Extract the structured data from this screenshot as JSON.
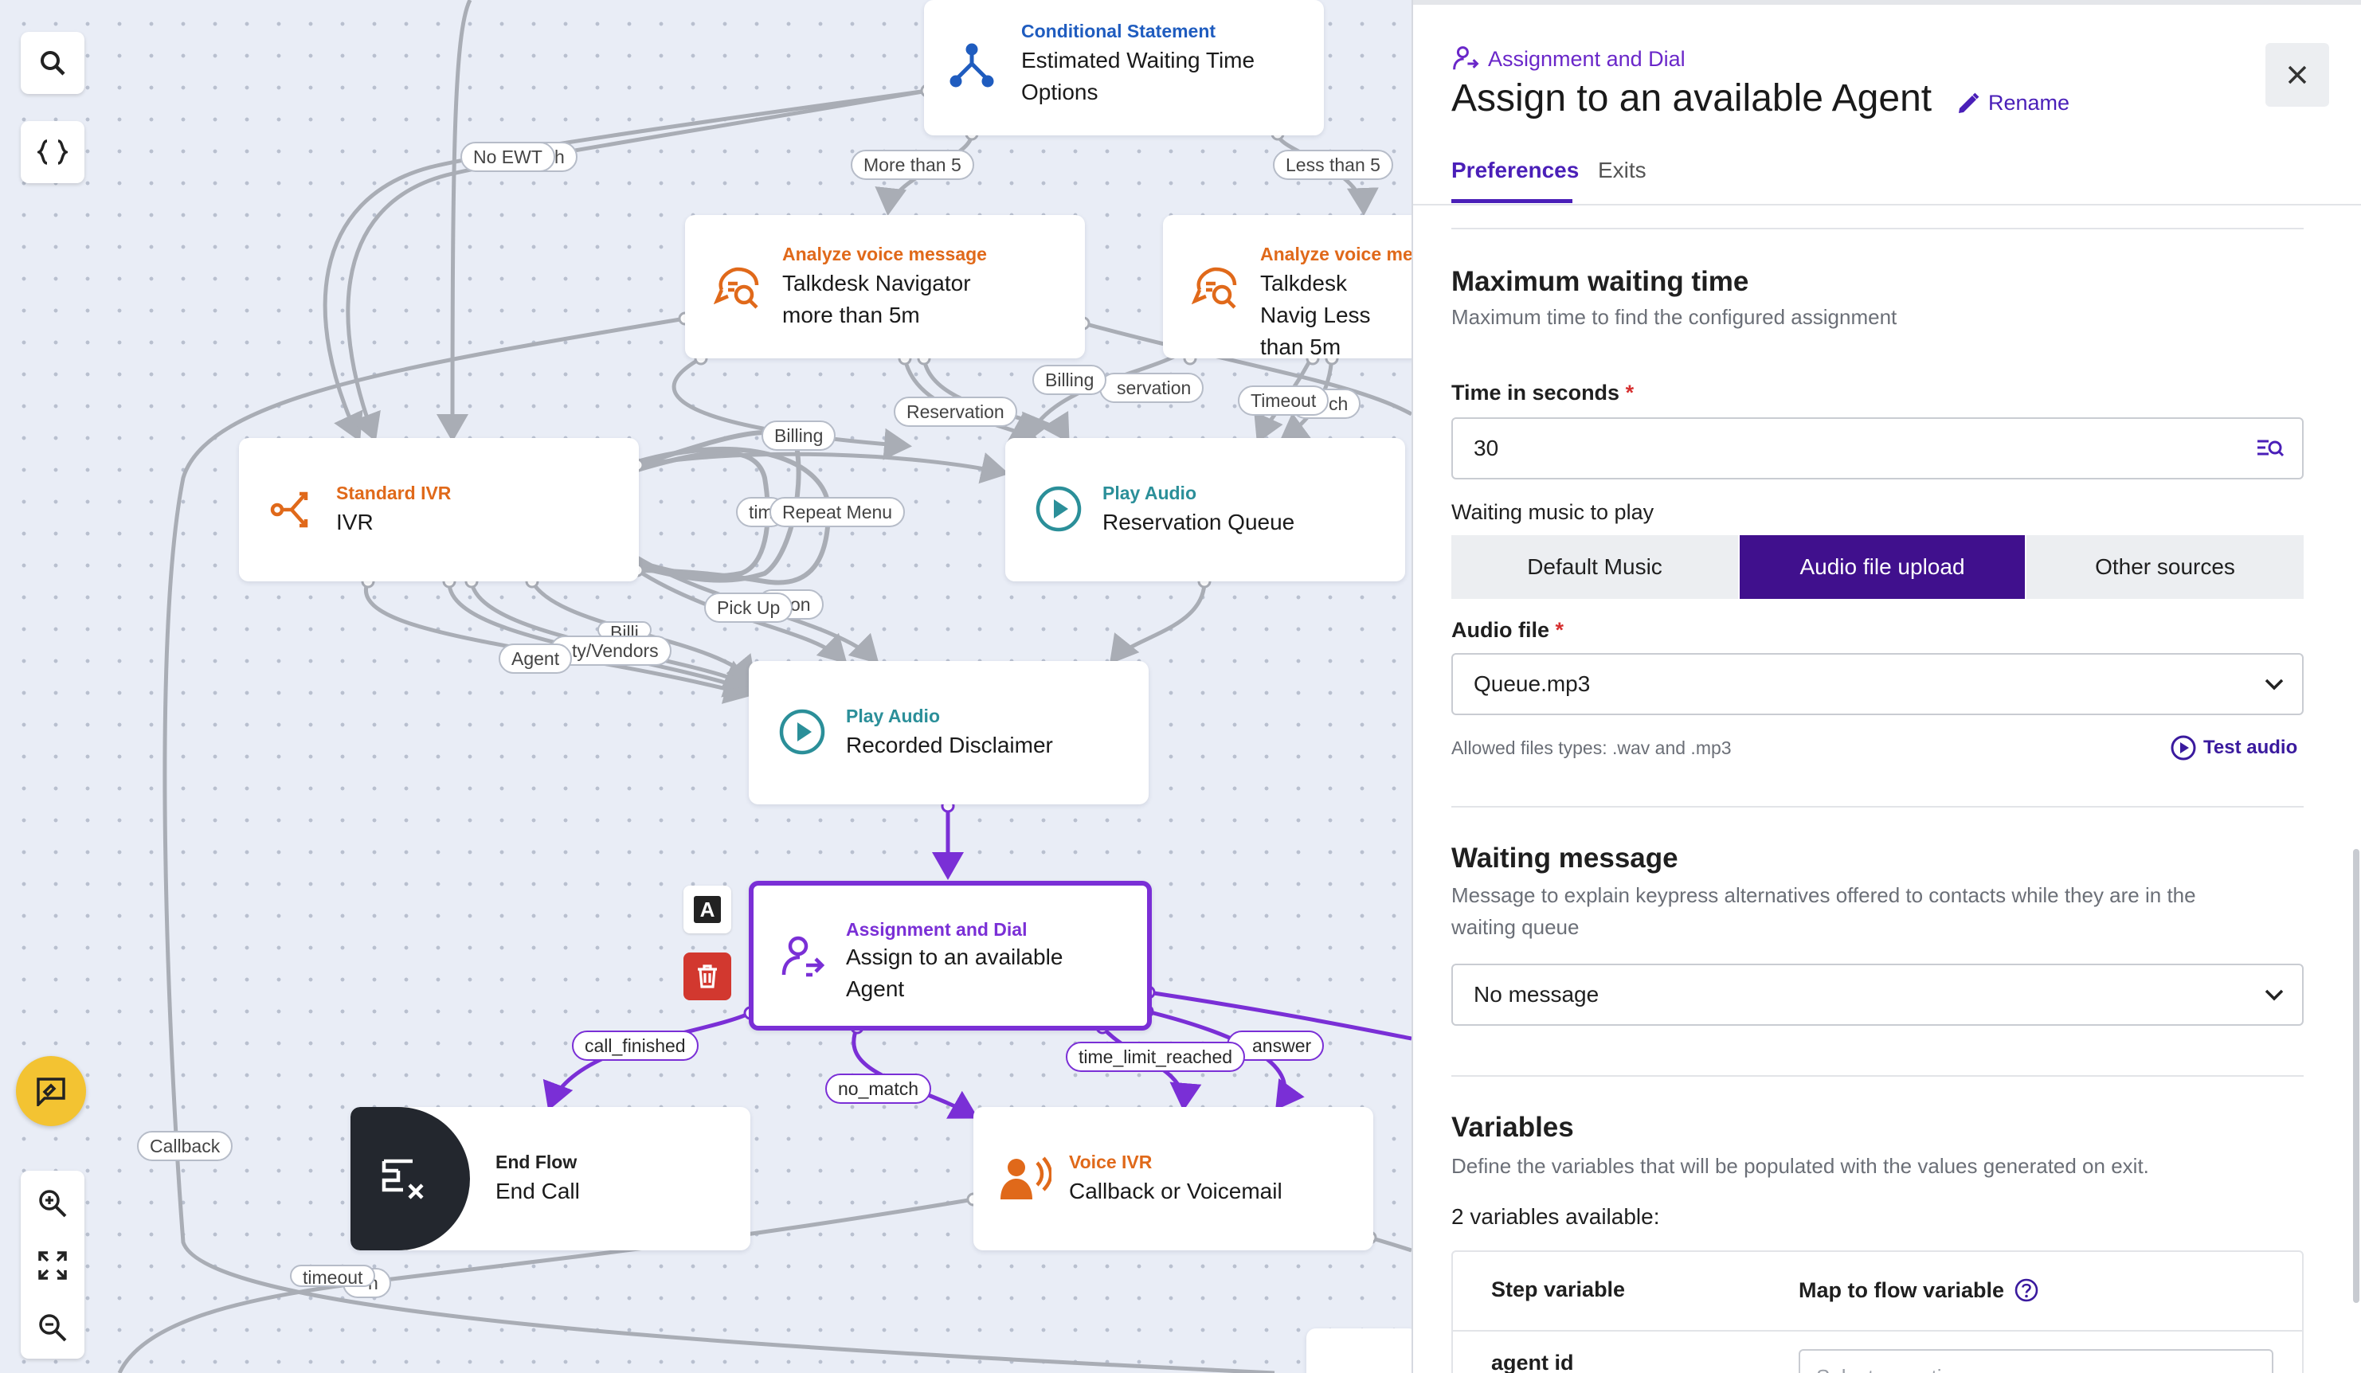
{
  "canvas": {
    "nodes": {
      "ewt": {
        "type": "Conditional Statement",
        "name": "Estimated Waiting Time Options"
      },
      "analyze1": {
        "type": "Analyze voice message",
        "name": "Talkdesk Navigator more than 5m"
      },
      "analyze2": {
        "type": "Analyze voice mes",
        "name": "Talkdesk Navig Less than 5m"
      },
      "ivr": {
        "type": "Standard IVR",
        "name": "IVR"
      },
      "reservation": {
        "type": "Play Audio",
        "name": "Reservation Queue"
      },
      "disclaimer": {
        "type": "Play Audio",
        "name": "Recorded Disclaimer"
      },
      "assign": {
        "type": "Assignment and Dial",
        "name": "Assign to an available Agent"
      },
      "endflow": {
        "type": "End Flow",
        "name": "End Call"
      },
      "voiceivr": {
        "type": "Voice IVR",
        "name": "Callback or Voicemail"
      }
    },
    "edge_labels": {
      "no_ewt": "No EWT",
      "no_ewt_hidden": "h",
      "more_than_5": "More than 5",
      "less_than_5": "Less than 5",
      "billing_1": "Billing",
      "billing_2": "Billing",
      "reservation_1": "Reservation",
      "reservation_2": "servation",
      "timeout": "Timeout",
      "timeout_hidden": "ch",
      "tim": "tim",
      "repeat_menu": "Repeat Menu",
      "pick_up": "Pick Up",
      "on_hidden": "on",
      "agent": "Agent",
      "vendors": "ty/Vendors",
      "billi": "Billi",
      "call_finished": "call_finished",
      "no_match": "no_match",
      "time_limit_reached": "time_limit_reached",
      "answer": "answer",
      "callback": "Callback",
      "timeout_bottom": "timeout",
      "timeout_bottom_hidden": "h"
    },
    "mini_text_label": "A",
    "colors": {
      "accent_purple": "#7a2fd6",
      "delete_red": "#d2382f",
      "feedback_yellow": "#f3c332"
    }
  },
  "panel": {
    "step_type": "Assignment and Dial",
    "title": "Assign to an available Agent",
    "rename_label": "Rename",
    "tabs": [
      {
        "label": "Preferences",
        "active": true
      },
      {
        "label": "Exits",
        "active": false
      }
    ],
    "max_wait": {
      "heading": "Maximum waiting time",
      "description": "Maximum time to find the configured assignment",
      "time_label": "Time in seconds",
      "required_mark": "*",
      "time_value": "30"
    },
    "music": {
      "label": "Waiting music to play",
      "options": [
        "Default Music",
        "Audio file upload",
        "Other sources"
      ],
      "selected": "Audio file upload"
    },
    "audio_file": {
      "label": "Audio file",
      "required_mark": "*",
      "value": "Queue.mp3",
      "hint": "Allowed files types: .wav and .mp3",
      "test_label": "Test audio"
    },
    "waiting_message": {
      "heading": "Waiting message",
      "description": "Message to explain keypress alternatives offered to contacts while they are in the waiting queue",
      "value": "No message"
    },
    "variables": {
      "heading": "Variables",
      "description": "Define the variables that will be populated with the values generated on exit.",
      "count_text": "2 variables available:",
      "col_step": "Step variable",
      "col_map": "Map to flow variable",
      "rows": [
        {
          "step": "agent id",
          "placeholder": "Select an option"
        }
      ]
    },
    "colors": {
      "primary": "#40108d",
      "link": "#4a1fb8"
    }
  }
}
